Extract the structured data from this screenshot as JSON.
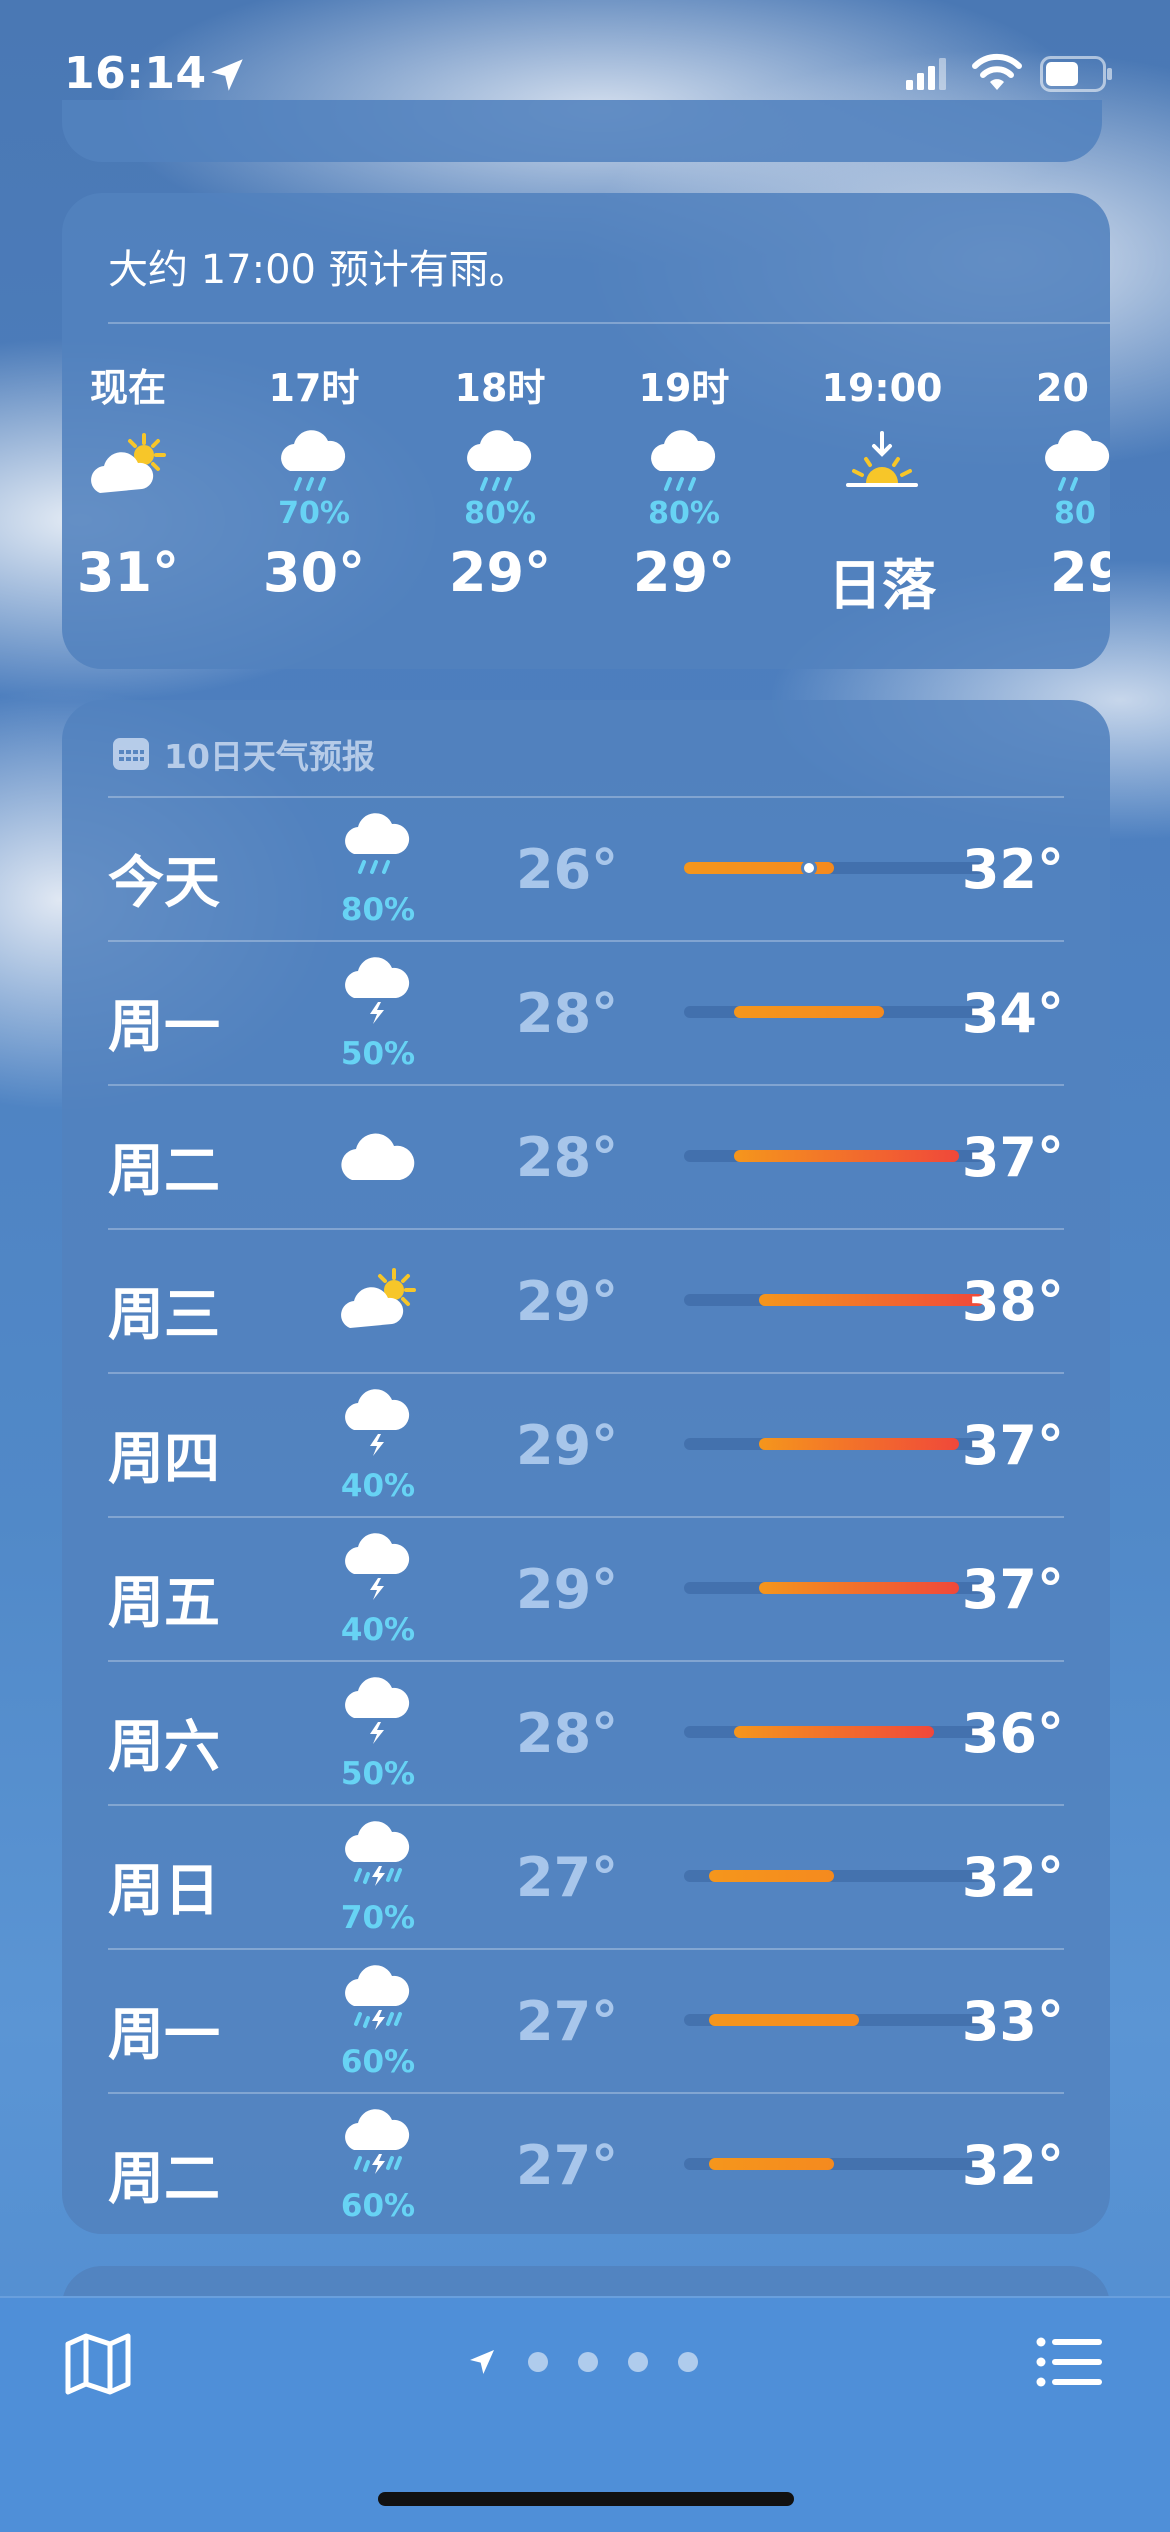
{
  "status_bar": {
    "time": "16:14"
  },
  "hourly": {
    "summary": "大约 17:00 预计有雨。",
    "items": [
      {
        "label": "现在",
        "icon": "partly-cloudy-icon",
        "pct": "",
        "temp": "31°"
      },
      {
        "label": "17时",
        "icon": "rain-icon",
        "pct": "70%",
        "temp": "30°"
      },
      {
        "label": "18时",
        "icon": "rain-icon",
        "pct": "80%",
        "temp": "29°"
      },
      {
        "label": "19时",
        "icon": "rain-icon",
        "pct": "80%",
        "temp": "29°"
      },
      {
        "label": "19:00",
        "icon": "sunset-icon",
        "pct": "",
        "temp": "日落"
      },
      {
        "label": "20",
        "icon": "rain-icon",
        "pct": "80",
        "temp": "29"
      }
    ]
  },
  "daily": {
    "header": "10日天气预报",
    "range": {
      "min": 26,
      "max": 38
    },
    "current_temp": 31,
    "days": [
      {
        "name": "今天",
        "icon": "rain-icon",
        "pct": "80%",
        "low": "26°",
        "high": "32°",
        "low_v": 26,
        "high_v": 32,
        "today": true
      },
      {
        "name": "周一",
        "icon": "thunderstorm-icon",
        "pct": "50%",
        "low": "28°",
        "high": "34°",
        "low_v": 28,
        "high_v": 34
      },
      {
        "name": "周二",
        "icon": "cloud-icon",
        "pct": "",
        "low": "28°",
        "high": "37°",
        "low_v": 28,
        "high_v": 37
      },
      {
        "name": "周三",
        "icon": "partly-cloudy-icon",
        "pct": "",
        "low": "29°",
        "high": "38°",
        "low_v": 29,
        "high_v": 38
      },
      {
        "name": "周四",
        "icon": "thunderstorm-icon",
        "pct": "40%",
        "low": "29°",
        "high": "37°",
        "low_v": 29,
        "high_v": 37
      },
      {
        "name": "周五",
        "icon": "thunderstorm-icon",
        "pct": "40%",
        "low": "29°",
        "high": "37°",
        "low_v": 29,
        "high_v": 37
      },
      {
        "name": "周六",
        "icon": "thunderstorm-icon",
        "pct": "50%",
        "low": "28°",
        "high": "36°",
        "low_v": 28,
        "high_v": 36
      },
      {
        "name": "周日",
        "icon": "thunder-rain-icon",
        "pct": "70%",
        "low": "27°",
        "high": "32°",
        "low_v": 27,
        "high_v": 32
      },
      {
        "name": "周一",
        "icon": "thunder-rain-icon",
        "pct": "60%",
        "low": "27°",
        "high": "33°",
        "low_v": 27,
        "high_v": 33
      },
      {
        "name": "周二",
        "icon": "thunder-rain-icon",
        "pct": "60%",
        "low": "27°",
        "high": "32°",
        "low_v": 27,
        "high_v": 32
      }
    ]
  },
  "toolbar": {
    "page_count": 4
  },
  "colors": {
    "accent_orange": "#f5961c",
    "accent_red": "#f0483a",
    "precip": "#67d3f4"
  }
}
